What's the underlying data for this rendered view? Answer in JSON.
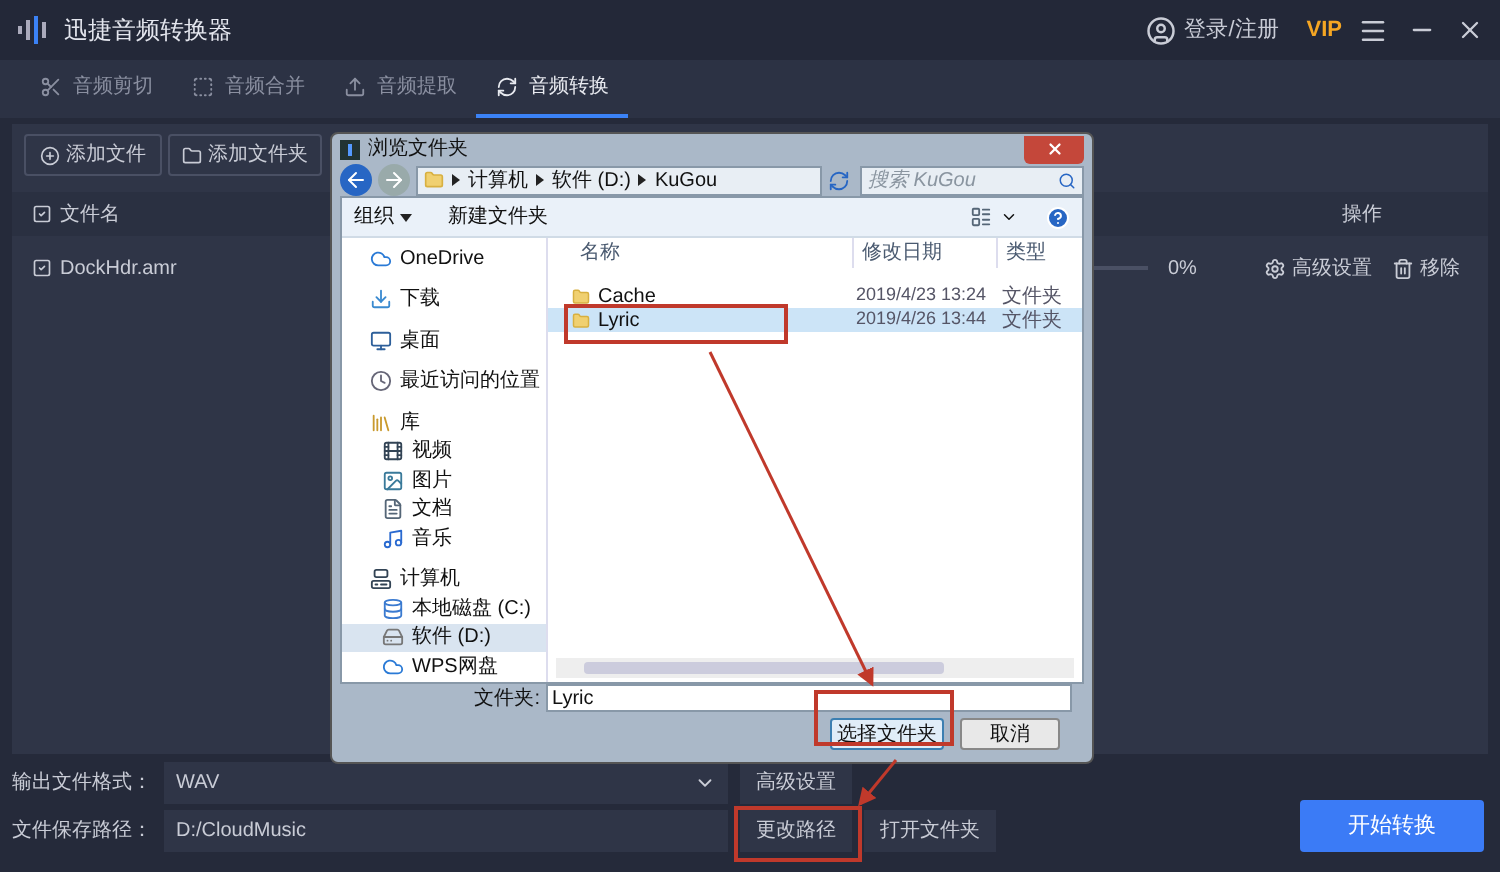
{
  "app": {
    "title": "迅捷音频转换器",
    "login": "登录/注册",
    "vip": "VIP"
  },
  "tabs": [
    {
      "label": "音频剪切",
      "kind": "cut",
      "selected": false
    },
    {
      "label": "音频合并",
      "kind": "merge",
      "selected": false
    },
    {
      "label": "音频提取",
      "kind": "extract",
      "selected": false
    },
    {
      "label": "音频转换",
      "kind": "convert",
      "selected": true
    }
  ],
  "toolbar": {
    "add_file": "添加文件",
    "add_folder": "添加文件夹"
  },
  "table": {
    "columns": [
      "文件名",
      "操作"
    ],
    "rows": [
      {
        "name": "DockHdr.amr",
        "level": 0,
        "percent": "0%",
        "settings": "高级设置",
        "remove": "移除"
      }
    ]
  },
  "dialog": {
    "title": "浏览文件夹",
    "breadcrumb": [
      "计算机",
      "软件 (D:)",
      "KuGou"
    ],
    "search": {
      "placeholder": "搜索 KuGou"
    },
    "organize": "组织",
    "new_folder": "新建文件夹",
    "nav": [
      {
        "label": "OneDrive",
        "kind": "cloud",
        "selected": false
      },
      {
        "label": "下载",
        "kind": "download",
        "selected": false
      },
      {
        "label": "桌面",
        "kind": "desktop",
        "selected": false
      },
      {
        "label": "最近访问的位置",
        "kind": "recent",
        "selected": false
      },
      {
        "label": "库",
        "kind": "library",
        "selected": false,
        "children": [
          {
            "label": "视频",
            "kind": "video",
            "selected": false
          },
          {
            "label": "图片",
            "kind": "image",
            "selected": false
          },
          {
            "label": "文档",
            "kind": "doc",
            "selected": false
          },
          {
            "label": "音乐",
            "kind": "music",
            "selected": false
          }
        ]
      },
      {
        "label": "计算机",
        "kind": "computer",
        "selected": false,
        "children": [
          {
            "label": "本地磁盘 (C:)",
            "kind": "disk",
            "selected": false
          },
          {
            "label": "软件 (D:)",
            "kind": "drive",
            "selected": true
          },
          {
            "label": "WPS网盘",
            "kind": "cloud",
            "selected": false
          }
        ]
      }
    ],
    "columns": [
      "名称",
      "修改日期",
      "类型"
    ],
    "files": [
      {
        "name": "Cache",
        "date": "2019/4/23 13:24",
        "type": "文件夹",
        "selected": false
      },
      {
        "name": "Lyric",
        "date": "2019/4/26 13:44",
        "type": "文件夹",
        "selected": true
      }
    ],
    "folder_label": "文件夹:",
    "folder_value": "Lyric",
    "ok": "选择文件夹",
    "cancel": "取消"
  },
  "bottom": {
    "format_label": "输出文件格式：",
    "format_value": "WAV",
    "advanced": "高级设置",
    "path_label": "文件保存路径：",
    "path_value": "D:/CloudMusic",
    "change_path": "更改路径",
    "open_folder": "打开文件夹",
    "start": "开始转换"
  }
}
